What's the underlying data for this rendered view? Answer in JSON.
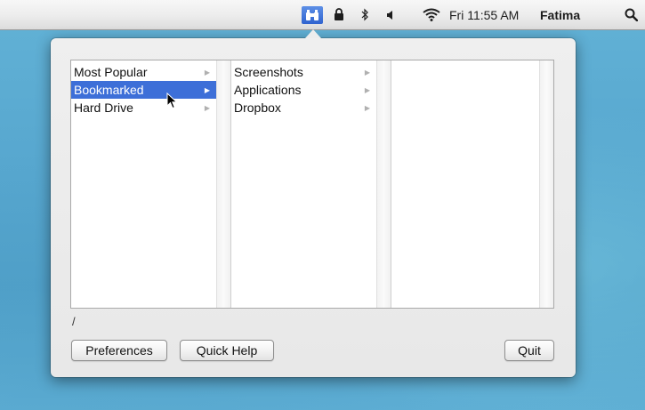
{
  "menubar": {
    "app_icon": "binoculars-icon",
    "status_icons": [
      "lock-icon",
      "bluetooth-icon",
      "volume-icon",
      "wifi-icon"
    ],
    "clock": "Fri 11:55 AM",
    "user": "Fatima",
    "search_icon": "spotlight-search-icon"
  },
  "browser": {
    "column1": [
      {
        "label": "Most Popular"
      },
      {
        "label": "Bookmarked",
        "selected": true
      },
      {
        "label": "Hard Drive"
      }
    ],
    "column2": [
      {
        "label": "Screenshots"
      },
      {
        "label": "Applications"
      },
      {
        "label": "Dropbox"
      }
    ],
    "column3": []
  },
  "path": "/",
  "buttons": {
    "preferences": "Preferences",
    "quick_help": "Quick Help",
    "quit": "Quit"
  },
  "colors": {
    "selection": "#3d6fd8",
    "desktop": "#5aa3c9",
    "app_icon_bg": "#2f63cf"
  }
}
